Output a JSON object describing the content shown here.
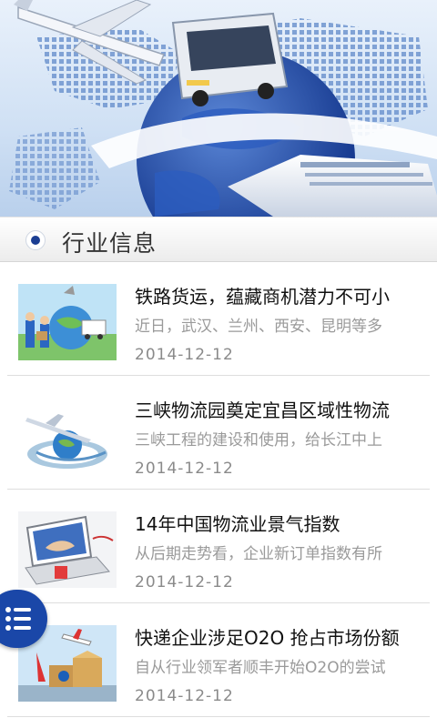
{
  "section": {
    "title": "行业信息"
  },
  "news": [
    {
      "title": "铁路货运，蕴藏商机潜力不可小",
      "summary": "近日，武汉、兰州、西安、昆明等多",
      "date": "2014-12-12",
      "thumb": "logistics-globe-people"
    },
    {
      "title": "三峡物流园奠定宜昌区域性物流",
      "summary": "三峡工程的建设和使用，给长江中上",
      "date": "2014-12-12",
      "thumb": "plane-globe"
    },
    {
      "title": "14年中国物流业景气指数",
      "summary": "从后期走势看，企业新订单指数有所",
      "date": "2014-12-12",
      "thumb": "laptop-handshake"
    },
    {
      "title": "快递企业涉足O2O 抢占市场份额",
      "summary": "自从行业领军者顺丰开始O2O的尝试",
      "date": "2014-12-12",
      "thumb": "plane-boxes"
    }
  ],
  "colors": {
    "accent": "#1a47a8",
    "title_text": "#111111",
    "summary_text": "#9a9a9a"
  },
  "icons": {
    "menu": "list-menu-icon",
    "section": "radio-dot-icon"
  }
}
